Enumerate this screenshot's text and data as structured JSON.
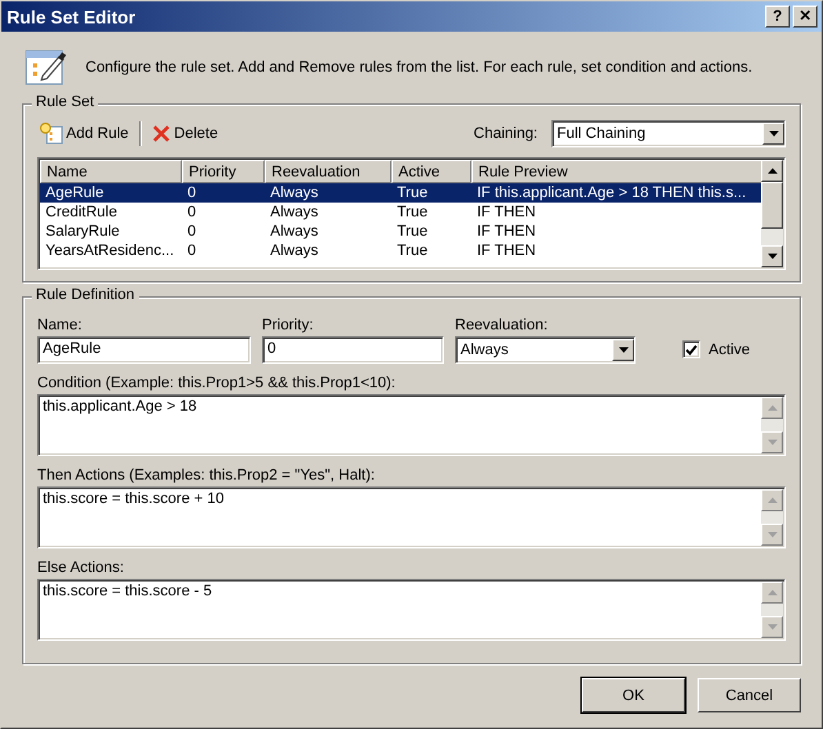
{
  "window": {
    "title": "Rule Set Editor",
    "help_button": "?",
    "close_button": "✕"
  },
  "description": "Configure the rule set. Add and Remove rules from the list. For each rule, set condition and actions.",
  "rule_set": {
    "title": "Rule Set",
    "toolbar": [
      {
        "label": "Add Rule",
        "kind": "add"
      },
      {
        "label": "Delete",
        "kind": "delete"
      }
    ],
    "chaining": {
      "label": "Chaining:",
      "value": "Full Chaining"
    },
    "table": {
      "columns": [
        "Name",
        "Priority",
        "Reevaluation",
        "Active",
        "Rule Preview"
      ],
      "rows": [
        {
          "cells": [
            "AgeRule",
            "0",
            "Always",
            "True",
            "IF this.applicant.Age > 18 THEN this.s..."
          ],
          "selected": true
        },
        {
          "cells": [
            "CreditRule",
            "0",
            "Always",
            "True",
            "IF THEN"
          ],
          "selected": false
        },
        {
          "cells": [
            "SalaryRule",
            "0",
            "Always",
            "True",
            "IF THEN"
          ],
          "selected": false
        },
        {
          "cells": [
            "YearsAtResidenc...",
            "0",
            "Always",
            "True",
            "IF THEN"
          ],
          "selected": false
        }
      ]
    }
  },
  "rule_definition": {
    "title": "Rule Definition",
    "name": {
      "label": "Name:",
      "value": "AgeRule"
    },
    "priority": {
      "label": "Priority:",
      "value": "0"
    },
    "reevaluation": {
      "label": "Reevaluation:",
      "value": "Always"
    },
    "active": {
      "label": "Active",
      "checked": true
    },
    "condition": {
      "label": "Condition (Example: this.Prop1>5 && this.Prop1<10):",
      "value": "this.applicant.Age > 18"
    },
    "then_actions": {
      "label": "Then Actions (Examples: this.Prop2 = \"Yes\", Halt):",
      "value": "this.score = this.score + 10"
    },
    "else_actions": {
      "label": "Else Actions:",
      "value": "this.score = this.score - 5"
    }
  },
  "buttons": [
    {
      "label": "OK",
      "default": true
    },
    {
      "label": "Cancel",
      "default": false
    }
  ]
}
